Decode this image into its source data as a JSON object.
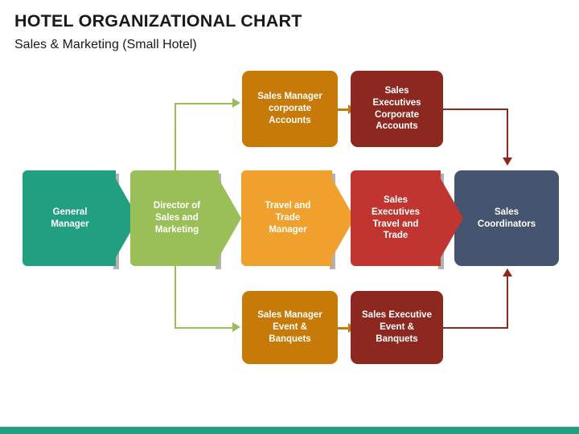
{
  "header": {
    "title": "HOTEL ORGANIZATIONAL CHART",
    "subtitle": "Sales & Marketing (Small Hotel)"
  },
  "colors": {
    "teal": "#229e80",
    "green": "#9abf58",
    "orange": "#f0a02c",
    "amber": "#c77a08",
    "red": "#c13530",
    "maroon": "#8c2820",
    "slate": "#46556f",
    "footer": "#229e80",
    "text_dark": "#1a1a1a",
    "text_light": "#ffffff"
  },
  "chart_data": {
    "type": "diagram",
    "title": "HOTEL ORGANIZATIONAL CHART",
    "subtitle": "Sales & Marketing (Small Hotel)",
    "nodes": [
      {
        "id": "general-manager",
        "label": "General\nManager",
        "color": "#229e80",
        "shape": "chevron",
        "row": "middle",
        "order": 1
      },
      {
        "id": "director-sales",
        "label": "Director of\nSales and\nMarketing",
        "color": "#9abf58",
        "shape": "chevron",
        "row": "middle",
        "order": 2
      },
      {
        "id": "travel-trade-manager",
        "label": "Travel and\nTrade\nManager",
        "color": "#f0a02c",
        "shape": "chevron",
        "row": "middle",
        "order": 3
      },
      {
        "id": "sales-exec-travel",
        "label": "Sales\nExecutives\nTravel and\nTrade",
        "color": "#c13530",
        "shape": "chevron",
        "row": "middle",
        "order": 4
      },
      {
        "id": "sales-coordinators",
        "label": "Sales\nCoordinators",
        "color": "#46556f",
        "shape": "rounded-rect",
        "row": "middle",
        "order": 5
      },
      {
        "id": "sales-mgr-corporate",
        "label": "Sales Manager\ncorporate\nAccounts",
        "color": "#c77a08",
        "shape": "rounded-rect",
        "row": "top",
        "order": 1
      },
      {
        "id": "sales-exec-corporate",
        "label": "Sales\nExecutives\nCorporate\nAccounts",
        "color": "#8c2820",
        "shape": "rounded-rect",
        "row": "top",
        "order": 2
      },
      {
        "id": "sales-mgr-events",
        "label": "Sales Manager\nEvent &\nBanquets",
        "color": "#c77a08",
        "shape": "rounded-rect",
        "row": "bottom",
        "order": 1
      },
      {
        "id": "sales-exec-events",
        "label": "Sales Executive\nEvent &\nBanquets",
        "color": "#8c2820",
        "shape": "rounded-rect",
        "row": "bottom",
        "order": 2
      }
    ],
    "edges": [
      {
        "from": "director-sales",
        "to": "sales-mgr-corporate",
        "color": "#9abf58"
      },
      {
        "from": "director-sales",
        "to": "sales-mgr-events",
        "color": "#9abf58"
      },
      {
        "from": "sales-mgr-corporate",
        "to": "sales-exec-corporate",
        "color": "#c77a08"
      },
      {
        "from": "sales-mgr-events",
        "to": "sales-exec-events",
        "color": "#c77a08"
      },
      {
        "from": "sales-exec-corporate",
        "to": "sales-coordinators",
        "color": "#8c2820"
      },
      {
        "from": "sales-exec-events",
        "to": "sales-coordinators",
        "color": "#8c2820"
      }
    ]
  },
  "nodes": {
    "general_manager": "General\nManager",
    "director_sales": "Director of\nSales and\nMarketing",
    "travel_trade_manager": "Travel and\nTrade\nManager",
    "sales_exec_travel": "Sales\nExecutives\nTravel and\nTrade",
    "sales_coordinators": "Sales\nCoordinators",
    "sales_mgr_corporate": "Sales Manager\ncorporate\nAccounts",
    "sales_exec_corporate": "Sales\nExecutives\nCorporate\nAccounts",
    "sales_mgr_events": "Sales Manager\nEvent &\nBanquets",
    "sales_exec_events": "Sales Executive\nEvent &\nBanquets"
  }
}
